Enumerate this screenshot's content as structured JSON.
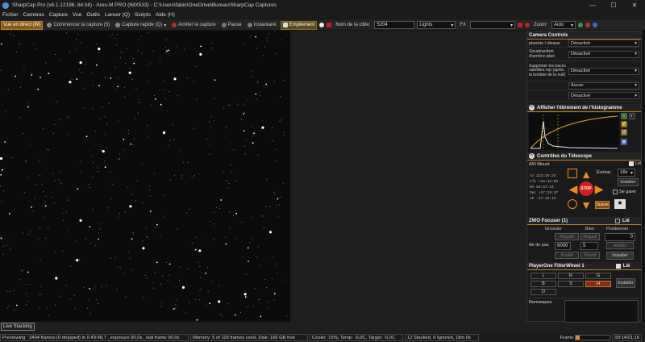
{
  "window": {
    "title": "SharpCap Pro (v4.1.12196, 64 bit) - Ares-M PRO (IMX533) - C:\\Users\\fabio\\OneDrive\\Bureau\\SharpCap Captures"
  },
  "menu": [
    "Fichier",
    "Caméras",
    "Capture",
    "Vue",
    "Outils",
    "Lancer (Q)",
    "Scripts",
    "Aide (H)"
  ],
  "toolbar": {
    "live": "Vue en direct (W)",
    "start": "Commencer la capture (5)",
    "quick": "Capture rapide (Q)",
    "stop": "Arrêter la capture",
    "pause": "Pause",
    "snapshot": "Instantané",
    "stack": "Empilement",
    "target_label": "Nom de la cible:",
    "target_value": "5204",
    "frame_type": "Lights",
    "fx_label": "FX",
    "zoom_label": "Zoom:",
    "zoom_value": "Auto"
  },
  "controls": {
    "header": "Camera Controls",
    "rows": [
      {
        "label": "planète / disque",
        "value": "Désactivé"
      },
      {
        "label": "Soustraction d'arrière-plan",
        "value": "Désactivé"
      },
      {
        "label": "Supprimer les traces satellites rop (après la tombée de la nuit)",
        "value": "Désactivé"
      },
      {
        "label": "Masquer les pixels exposés",
        "value": "Aucun"
      },
      {
        "label": "",
        "value": "Désactivé"
      }
    ]
  },
  "histogram": {
    "header": "Afficher l'étirement de l'histogramme"
  },
  "telescope": {
    "header": "Contrôles du Télescope",
    "mount": "ASI Mount",
    "link": "Lié",
    "evolve_label": "Évolue:",
    "evolve_value": "16x",
    "install": "Installer",
    "coords": [
      {
        "k": "Az",
        "v": "223:29:25"
      },
      {
        "k": "Alt",
        "v": "+34:15:03"
      },
      {
        "k": "RA",
        "v": "03:57:44"
      },
      {
        "k": "Dec",
        "v": "+37:29:37"
      },
      {
        "k": "AE",
        "v": "-37:46:44"
      }
    ],
    "guide": "Se garer",
    "suivre": "Suivre",
    "center": "STOP"
  },
  "focuser": {
    "header": "ZWO Focuser (1)",
    "link": "Lié",
    "grosser": "Grossier",
    "bien": "Bien",
    "positioner": "Positionner",
    "neg1": "Négatif",
    "neg2": "Négatif",
    "pos_value": "0",
    "step_label": "ille de pas",
    "step1": "6000",
    "step2": "5",
    "stop": "Arrêter",
    "pos1": "Positif",
    "pos2": "Positif",
    "install": "Installer"
  },
  "filterwheel": {
    "header": "PlayerOne FilterWheel 1",
    "link": "Lié",
    "filters": [
      "L",
      "R",
      "G",
      "B",
      "S",
      "H",
      "O"
    ],
    "install": "Installer"
  },
  "remarks": {
    "label": "Remarques"
  },
  "live_stack_tab": "Live Stacking",
  "status": {
    "preview": "Previewing : 3404 frames (0 dropped) in 0:49:48,7 , exposure 90,0s , last frame 90,0s",
    "memory": "Memory: 5 of 118 frames used, Disk: 166 GB free",
    "cooler": "Cooler: 15%, Temp: -5,0C, Target: -5,0C",
    "stacked": "12 Stacked, 0 Ignored, 18m 0s",
    "frame_label": "Frame",
    "frame_progress": 0.12,
    "time": "00:14/01:16"
  }
}
